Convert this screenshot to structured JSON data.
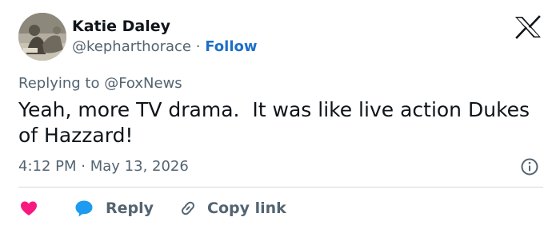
{
  "author": {
    "name": "Katie Daley",
    "handle": "@kepharthorace",
    "separator": "·",
    "follow_label": "Follow"
  },
  "platform_icon": "x-logo-icon",
  "reply_context": {
    "prefix": "Replying to",
    "mention": "@FoxNews"
  },
  "tweet": {
    "text": "Yeah, more TV drama.  It was like live action Dukes of Hazzard!",
    "time": "4:12 PM",
    "separator": "·",
    "date": "May 13, 2026"
  },
  "actions": {
    "like_icon": "heart-icon",
    "reply_icon": "reply-bubble-icon",
    "reply_label": "Reply",
    "copy_icon": "link-icon",
    "copy_label": "Copy link"
  },
  "colors": {
    "heart": "#f91880",
    "reply_bubble": "#1d9bf0",
    "follow": "#1d6fc8",
    "muted": "#536471",
    "text": "#0f1419"
  }
}
